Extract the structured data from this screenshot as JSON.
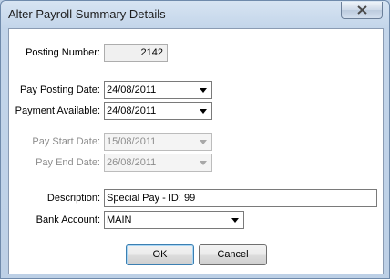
{
  "window": {
    "title": "Alter Payroll Summary Details"
  },
  "icons": {
    "close": "close-x-icon",
    "dropdown": "chevron-down-icon"
  },
  "form": {
    "posting_number": {
      "label": "Posting Number:",
      "value": "2142"
    },
    "pay_posting_date": {
      "label": "Pay Posting Date:",
      "value": "24/08/2011"
    },
    "payment_available": {
      "label": "Payment Available:",
      "value": "24/08/2011"
    },
    "pay_start_date": {
      "label": "Pay Start Date:",
      "value": "15/08/2011",
      "enabled": false
    },
    "pay_end_date": {
      "label": "Pay End Date:",
      "value": "26/08/2011",
      "enabled": false
    },
    "description": {
      "label": "Description:",
      "value": "Special Pay - ID: 99"
    },
    "bank_account": {
      "label": "Bank Account:",
      "value": "MAIN"
    }
  },
  "buttons": {
    "ok": "OK",
    "cancel": "Cancel"
  }
}
